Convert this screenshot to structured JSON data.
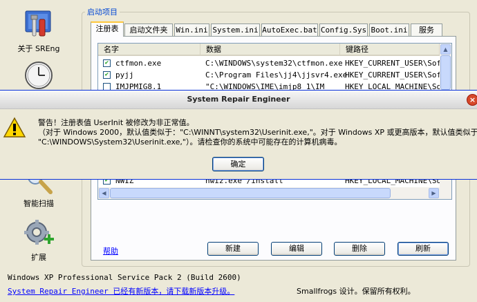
{
  "sidebar": {
    "items": [
      {
        "label": "关于 SREng",
        "icon": "toolbox-icon"
      },
      {
        "label": "",
        "icon": "clock-icon"
      },
      {
        "label": "智能扫描",
        "icon": "magnifier-icon"
      },
      {
        "label": "扩展",
        "icon": "puzzle-add-icon"
      }
    ]
  },
  "group": {
    "title": "启动项目"
  },
  "tabs": [
    "注册表",
    "启动文件夹",
    "Win.ini",
    "System.ini",
    "AutoExec.bat",
    "Config.Sys",
    "Boot.ini",
    "服务"
  ],
  "active_tab": "注册表",
  "list": {
    "columns": [
      "名字",
      "数据",
      "键路径"
    ],
    "rows": [
      {
        "checked": true,
        "name": "ctfmon.exe",
        "data": "C:\\WINDOWS\\system32\\ctfmon.exe",
        "path": "HKEY_CURRENT_USER\\Soft"
      },
      {
        "checked": true,
        "name": "pyjj",
        "data": "C:\\Program Files\\jj4\\jjsvr4.exe",
        "path": "HKEY_CURRENT_USER\\Soft"
      },
      {
        "checked": false,
        "name": "IMJPMIG8.1",
        "data": "\"C:\\WINDOWS\\IME\\imjp8_1\\IM",
        "path": "HKEY_LOCAL_MACHINE\\Sof"
      },
      {
        "checked": true,
        "name": "NWIZ",
        "data": "nwiz.exe /install",
        "path": "HKEY_LOCAL_MACHINE\\Sof"
      }
    ]
  },
  "buttons": {
    "help": "帮助",
    "new": "新建",
    "edit": "编辑",
    "delete": "删除",
    "refresh": "刷新"
  },
  "footer": {
    "os_info": "Windows XP Professional Service Pack 2 (Build 2600)",
    "update_link": "System Repair Engineer 已经有新版本，请下载新版本升级。",
    "copyright": "Smallfrogs 设计。保留所有权利。"
  },
  "dialog": {
    "title": "System Repair Engineer",
    "line1": "警告！注册表值 UserInit 被修改为非正常值。",
    "line2": "（对于 Windows 2000，默认值类似于：\"C:\\WINNT\\system32\\Userinit.exe,\"。对于 Windows XP 或更高版本，默认值类似于：",
    "line3": "\"C:\\WINDOWS\\System32\\Userinit.exe,\"）。请检查你的系统中可能存在的计算机病毒。",
    "ok": "确定",
    "close_glyph": "×"
  },
  "colors": {
    "accent": "#0046d5",
    "link": "#0000ff",
    "tab_highlight": "#ffc83c"
  }
}
